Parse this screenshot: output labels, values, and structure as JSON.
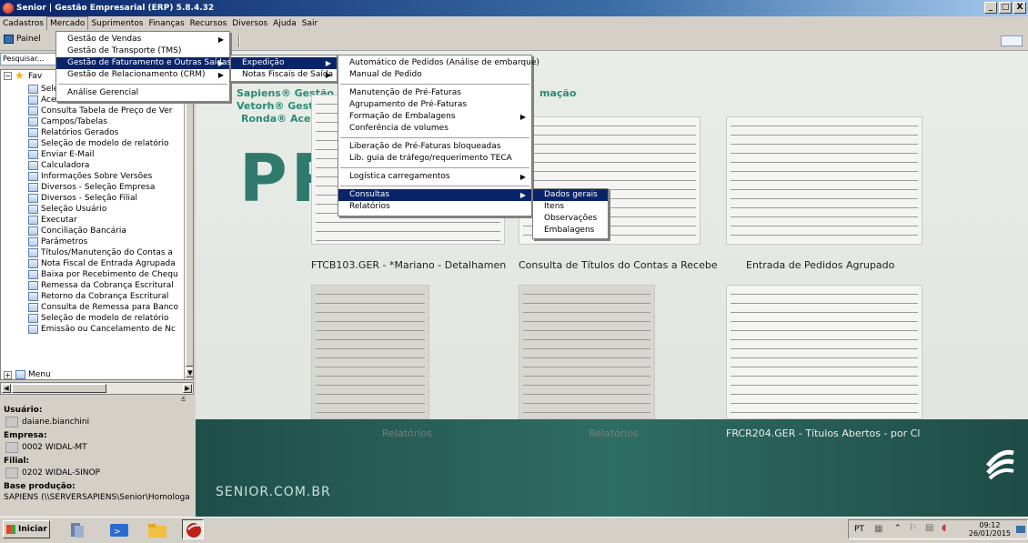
{
  "window": {
    "title": "Senior | Gestão Empresarial (ERP) 5.8.4.32",
    "btn_min": "_",
    "btn_max": "□",
    "btn_close": "X"
  },
  "menubar": [
    "Cadastros",
    "Mercado",
    "Suprimentos",
    "Finanças",
    "Recursos",
    "Diversos",
    "Ajuda",
    "Sair"
  ],
  "toolbar": {
    "painel_label": "Painel"
  },
  "left": {
    "search_placeholder": "Pesquisar...",
    "tree_root": "Fav",
    "tree_items": [
      "Seleção Usuário",
      "Acesso rápido",
      "Consulta Tabela de Preço de Ver",
      "Campos/Tabelas",
      "Relatórios Gerados",
      "Seleção de modelo de relatório",
      "Enviar E-Mail",
      "Calculadora",
      "Informações Sobre Versões",
      "Diversos - Seleção Empresa",
      "Diversos - Seleção Filial",
      "Seleção Usuário",
      "Executar",
      "Conciliação Bancária",
      "Parâmetros",
      "Títulos/Manutenção do Contas a",
      "Nota Fiscal de Entrada Agrupada",
      "Baixa por Recebimento de Chequ",
      "Remessa da Cobrança Escritural",
      "Retorno da Cobrança Escritural",
      "Consulta de Remessa para Banco",
      "Seleção de modelo de relatório",
      "Emissão ou Cancelamento de Nc"
    ],
    "menu_node": "Menu",
    "usuario_label": "Usuário:",
    "usuario_value": "daiane.bianchini",
    "empresa_label": "Empresa:",
    "empresa_value": "0002 WIDAL-MT",
    "filial_label": "Filial:",
    "filial_value": "0202 WIDAL-SINOP",
    "base_label": "Base produção:",
    "base_value": "SAPIENS (\\\\SERVERSAPIENS\\Senior\\Homologa"
  },
  "menu1": [
    "Gestão de Vendas",
    "Gestão de Transporte (TMS)",
    "Gestão de Faturamento e Outras Saídas",
    "Gestão de Relacionamento (CRM)",
    "Análise Gerencial"
  ],
  "menu2": [
    "Expedição",
    "Notas Fiscais de Saída"
  ],
  "menu3": [
    "Automático de Pedidos (Análise de embarque)",
    "Manual de Pedido",
    "Manutenção de Pré-Faturas",
    "Agrupamento de Pré-Faturas",
    "Formação de Embalagens",
    "Conferência de volumes",
    "Liberação de Pré-Faturas bloqueadas",
    "Lib. guia de tráfego/requerimento TECA",
    "Logística carregamentos",
    "Consultas",
    "Relatórios"
  ],
  "menu4": [
    "Dados gerais",
    "Itens",
    "Observações",
    "Embalagens"
  ],
  "main": {
    "sapiens_lines": [
      "Sapiens® Gestão Em",
      "Vetorh® Gestão de",
      "Ronda® Acess"
    ],
    "mação": "mação",
    "big_letters": "PR",
    "thumb_labels": [
      "FTCB103.GER - *Mariano - Detalhamen",
      "Consulta de Títulos do Contas a Recebe",
      "Entrada de Pedidos Agrupado",
      "Relatórios",
      "Relatórios",
      "FRCR204.GER - Títulos Abertos - por Cl"
    ],
    "footer_text": "SENIOR.COM.BR"
  },
  "taskbar": {
    "start_label": "Iniciar",
    "lang": "PT",
    "time": "09:12",
    "date": "26/01/2015"
  },
  "colors": {
    "menu_highlight": "#0a246a",
    "title_gradient_start": "#0a246a",
    "brand_green": "#2f7a6c"
  }
}
